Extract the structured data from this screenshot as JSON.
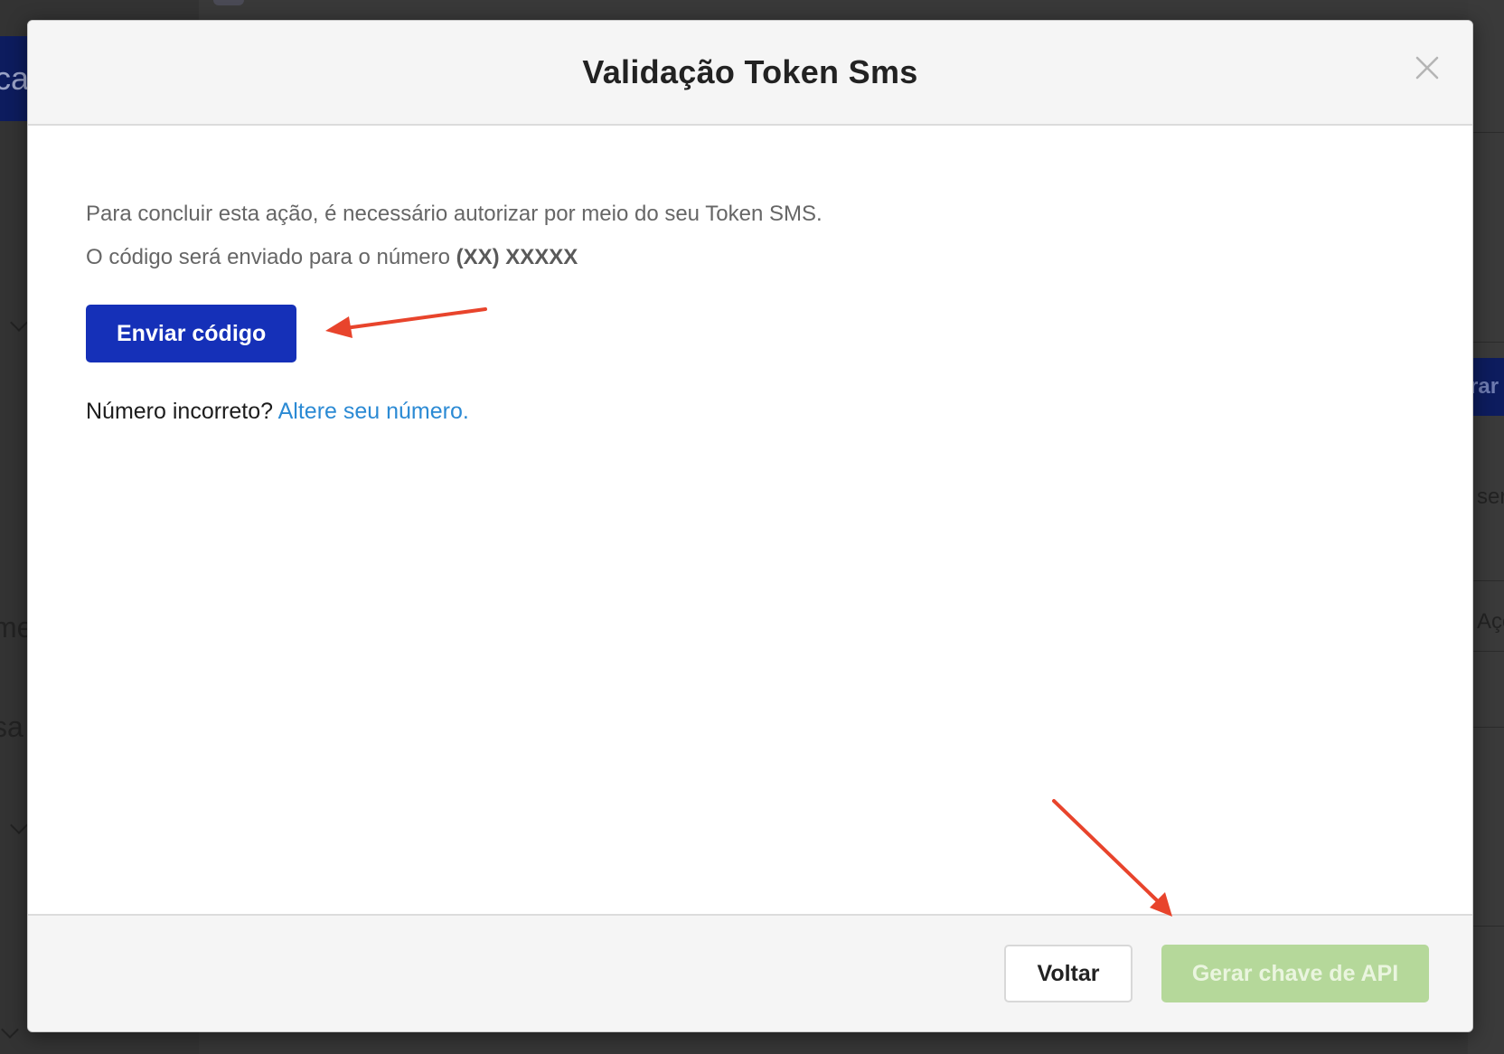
{
  "background": {
    "sidebar_fragment": "ca",
    "sidebar_fragment_2": "me",
    "sidebar_fragment_3": "sa",
    "right_button_fragment": "rar",
    "right_text_1": "ser",
    "right_text_2": "Açõ"
  },
  "modal": {
    "title": "Validação Token Sms",
    "description": "Para concluir esta ação, é necessário autorizar por meio do seu Token SMS.",
    "code_sent_prefix": "O código será enviado para o número",
    "phone_masked": "(XX) XXXXX",
    "send_code_label": "Enviar código",
    "wrong_number_text": "Número incorreto?",
    "change_number_link": "Altere seu número.",
    "back_label": "Voltar",
    "generate_api_key_label": "Gerar chave de API"
  },
  "colors": {
    "primary_button": "#1530b8",
    "link": "#2b8ad4",
    "disabled_green": "#b5d89a",
    "annotation_arrow": "#e8442c"
  }
}
